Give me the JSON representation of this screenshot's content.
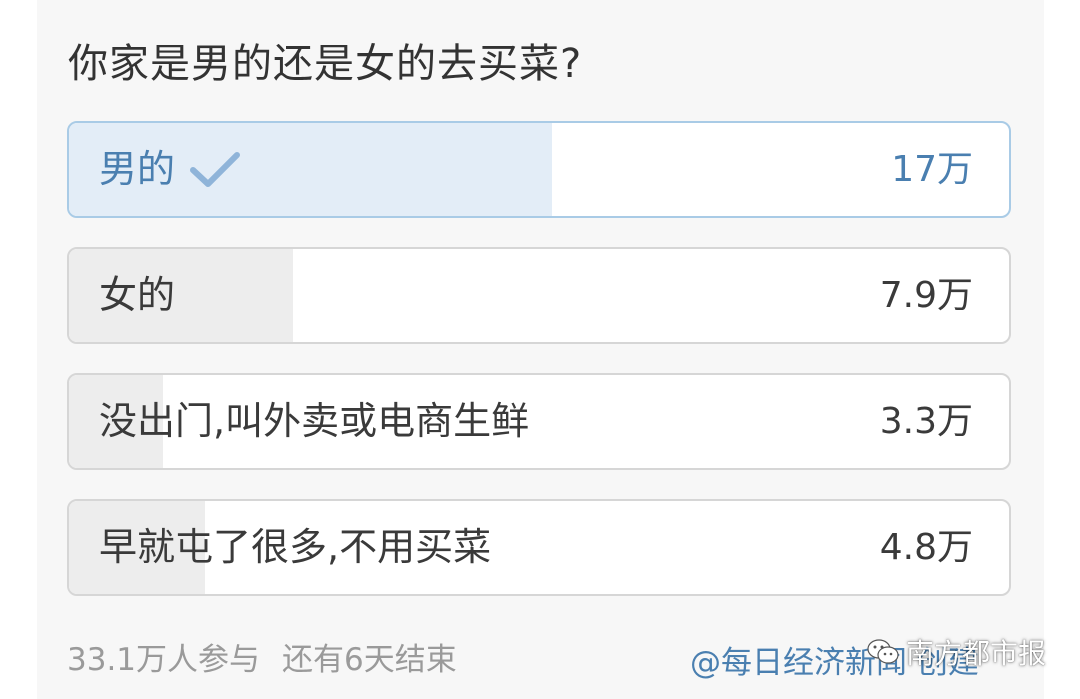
{
  "poll": {
    "question": "你家是男的还是女的去买菜?",
    "options": [
      {
        "label": "男的",
        "count": "17万",
        "share": 0.5136,
        "selected": true
      },
      {
        "label": "女的",
        "count": "7.9万",
        "share": 0.2387,
        "selected": false
      },
      {
        "label": "没出门,叫外卖或电商生鲜",
        "count": "3.3万",
        "share": 0.0997,
        "selected": false
      },
      {
        "label": "早就屯了很多,不用买菜",
        "count": "4.8万",
        "share": 0.145,
        "selected": false
      }
    ]
  },
  "footer": {
    "participants": "33.1万人参与",
    "time_left": "还有6天结束",
    "creator": "@每日经济新闻 创建"
  },
  "watermark": {
    "text": "南方都市报",
    "icon": "wechat-icon"
  },
  "colors": {
    "accent": "#4a7fb0",
    "selected_fill": "#e3edf7",
    "bar_fill": "#ededed"
  }
}
